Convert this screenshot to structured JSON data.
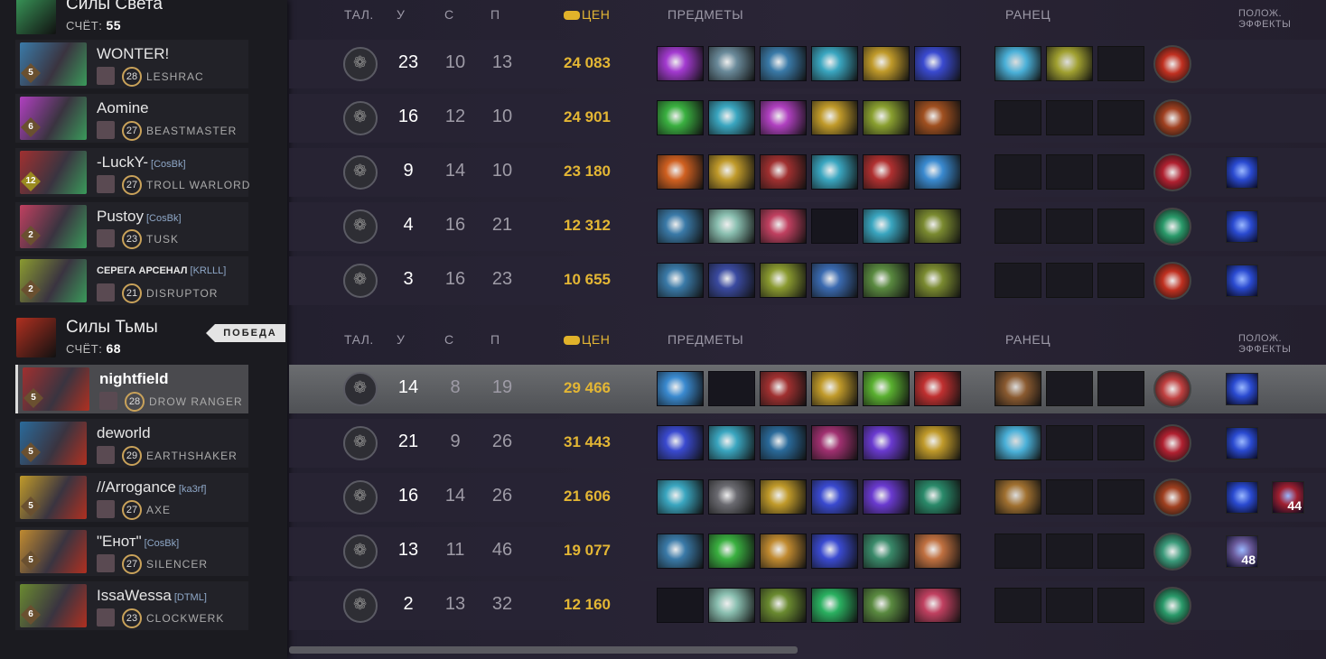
{
  "teams": [
    {
      "name": "Силы Света",
      "score_label": "СЧЁТ:",
      "score": "55",
      "color": "#3a9a5a",
      "headers": {
        "talents": "ТАЛ.",
        "kills": "У",
        "deaths": "С",
        "assists": "П",
        "networth": "ЦЕН",
        "items": "ПРЕДМЕТЫ",
        "backpack": "РАНЕЦ",
        "buffs": "ПОЛОЖ. ЭФФЕКТЫ"
      },
      "players": [
        {
          "name": "WONTER!",
          "tag": "",
          "level": "28",
          "hero": "LESHRAC",
          "rank": "5",
          "kills": "23",
          "deaths": "10",
          "assists": "13",
          "networth": "24 083",
          "items": [
            "#a33ad0",
            "#6a8a9a",
            "#3a7aa8",
            "#3aa6c0",
            "#c09a2a",
            "#3a4ad0"
          ],
          "backpack": [
            "#4ab0d8",
            "#a0a030",
            ""
          ],
          "neutral": "#c03020",
          "buffs": []
        },
        {
          "name": "Aomine",
          "tag": "",
          "level": "27",
          "hero": "BEASTMASTER",
          "rank": "6",
          "kills": "16",
          "deaths": "12",
          "assists": "10",
          "networth": "24 901",
          "items": [
            "#3ab040",
            "#3aa6c0",
            "#b040c0",
            "#c09a2a",
            "#8aa030",
            "#a05020"
          ],
          "backpack": [
            "",
            "",
            ""
          ],
          "neutral": "#a04020",
          "buffs": []
        },
        {
          "name": "-LuckY-",
          "tag": "[CosBk]",
          "level": "27",
          "hero": "TROLL WARLORD",
          "rank": "12",
          "kills": "9",
          "deaths": "14",
          "assists": "10",
          "networth": "23 180",
          "items": [
            "#d06020",
            "#c09a2a",
            "#a03030",
            "#3aa6c0",
            "#b03030",
            "#3a8ad0"
          ],
          "backpack": [
            "",
            "",
            ""
          ],
          "neutral": "#b02030",
          "buffs": [
            {
              "color": "#2a4ad0",
              "count": ""
            }
          ]
        },
        {
          "name": "Pustoy",
          "tag": "[CosBk]",
          "level": "23",
          "hero": "TUSK",
          "rank": "2",
          "kills": "4",
          "deaths": "16",
          "assists": "21",
          "networth": "12 312",
          "items": [
            "#3a7aa8",
            "#8abfb0",
            "#c04060",
            "",
            "#3aa6c0",
            "#7a8a30"
          ],
          "backpack": [
            "",
            "",
            ""
          ],
          "neutral": "#2a9a6a",
          "buffs": [
            {
              "color": "#2a4ad0",
              "count": ""
            }
          ]
        },
        {
          "name": "СЕРЕГА АРСЕНАЛ",
          "tag": "[KRLLL]",
          "level": "21",
          "hero": "DISRUPTOR",
          "rank": "2",
          "kills": "3",
          "deaths": "16",
          "assists": "23",
          "networth": "10 655",
          "items": [
            "#3a7aa8",
            "#3a4aa0",
            "#8a9a30",
            "#3a6ab0",
            "#5a8a40",
            "#7a8a30"
          ],
          "backpack": [
            "",
            "",
            ""
          ],
          "neutral": "#c03020",
          "buffs": [
            {
              "color": "#2a4ad0",
              "count": ""
            }
          ]
        }
      ]
    },
    {
      "name": "Силы Тьмы",
      "score_label": "СЧЁТ:",
      "score": "68",
      "color": "#b03020",
      "victory": "ПОБЕДА",
      "headers": {
        "talents": "ТАЛ.",
        "kills": "У",
        "deaths": "С",
        "assists": "П",
        "networth": "ЦЕН",
        "items": "ПРЕДМЕТЫ",
        "backpack": "РАНЕЦ",
        "buffs": "ПОЛОЖ. ЭФФЕКТЫ"
      },
      "players": [
        {
          "name": "nightfield",
          "tag": "",
          "level": "28",
          "hero": "DROW RANGER",
          "rank": "5",
          "kills": "14",
          "deaths": "8",
          "assists": "19",
          "networth": "29 466",
          "items": [
            "#3a8ad0",
            "",
            "#a03030",
            "#c09a2a",
            "#5ab030",
            "#c03030"
          ],
          "backpack": [
            "#8a5a30",
            "",
            ""
          ],
          "neutral": "#c04040",
          "buffs": [
            {
              "color": "#2a4ad0",
              "count": ""
            }
          ]
        },
        {
          "name": "deworld",
          "tag": "",
          "level": "29",
          "hero": "EARTHSHAKER",
          "rank": "5",
          "kills": "21",
          "deaths": "9",
          "assists": "26",
          "networth": "31 443",
          "items": [
            "#3a4ad0",
            "#3aa6c0",
            "#2a6a9a",
            "#a03070",
            "#6a3ad0",
            "#c09a2a"
          ],
          "backpack": [
            "#4ab0d8",
            "",
            ""
          ],
          "neutral": "#b02030",
          "buffs": [
            {
              "color": "#2a4ad0",
              "count": ""
            }
          ]
        },
        {
          "name": "//Arrogance",
          "tag": "[ka3rf]",
          "level": "27",
          "hero": "AXE",
          "rank": "5",
          "kills": "16",
          "deaths": "14",
          "assists": "26",
          "networth": "21 606",
          "items": [
            "#3aa6c0",
            "#6a6a70",
            "#c09a2a",
            "#3a4ad0",
            "#6a3ad0",
            "#2a8a6a"
          ],
          "backpack": [
            "#a07030",
            "",
            ""
          ],
          "neutral": "#a04020",
          "buffs": [
            {
              "color": "#2a4ad0",
              "count": ""
            },
            {
              "color": "#a02030",
              "count": "44"
            }
          ]
        },
        {
          "name": "\"Енот\"",
          "tag": "[CosBk]",
          "level": "27",
          "hero": "SILENCER",
          "rank": "5",
          "kills": "13",
          "deaths": "11",
          "assists": "46",
          "networth": "19 077",
          "items": [
            "#3a7aa8",
            "#3ab040",
            "#c08a30",
            "#3a4ad0",
            "#3a8a6a",
            "#c07040"
          ],
          "backpack": [
            "",
            "",
            ""
          ],
          "neutral": "#3a9a7a",
          "buffs": [
            {
              "color": "#6a5a9a",
              "count": "48"
            }
          ]
        },
        {
          "name": "IssaWessa",
          "tag": "[DTML]",
          "level": "23",
          "hero": "CLOCKWERK",
          "rank": "6",
          "kills": "2",
          "deaths": "13",
          "assists": "32",
          "networth": "12 160",
          "items": [
            "",
            "#8abfb0",
            "#6a8a30",
            "#2ab060",
            "#5a8a40",
            "#c04060"
          ],
          "backpack": [
            "",
            "",
            ""
          ],
          "neutral": "#2a9a6a",
          "buffs": []
        }
      ]
    }
  ]
}
